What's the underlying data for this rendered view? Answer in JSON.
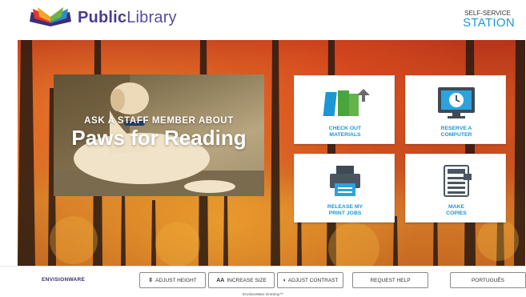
{
  "header": {
    "brand_bold": "Public",
    "brand_light": "Library",
    "station_small": "SELF-SERVICE",
    "station_big": "STATION"
  },
  "promo": {
    "line1": "ASK A STAFF MEMBER ABOUT",
    "line2": "Paws for Reading"
  },
  "tiles": [
    {
      "label_l1": "CHECK OUT",
      "label_l2": "MATERIALS",
      "icon": "books-icon"
    },
    {
      "label_l1": "RESERVE A",
      "label_l2": "COMPUTER",
      "icon": "computer-clock-icon"
    },
    {
      "label_l1": "RELEASE MY",
      "label_l2": "PRINT JOBS",
      "icon": "printer-icon"
    },
    {
      "label_l1": "MAKE",
      "label_l2": "COPIES",
      "icon": "copier-icon"
    }
  ],
  "bottom": {
    "logo_text": "ENVISIONWARE",
    "adjust_height": "ADJUST HEIGHT",
    "increase_size_prefix": "AA",
    "increase_size": "INCREASE SIZE",
    "adjust_contrast": "ADJUST CONTRAST",
    "request_help": "REQUEST HELP",
    "language": "PORTUGUÊS",
    "footer_note": "EnvisionWare OneStop™"
  },
  "colors": {
    "brand": "#4a3b8f",
    "accent": "#1b97d4"
  }
}
